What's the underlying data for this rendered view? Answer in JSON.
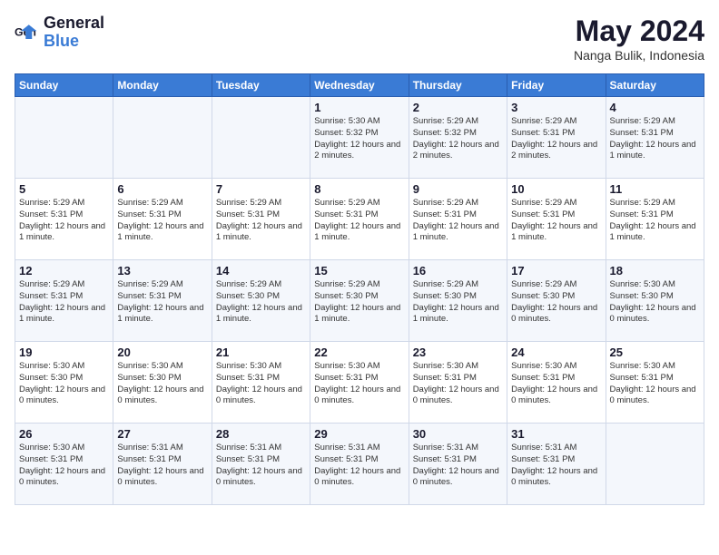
{
  "logo": {
    "text_general": "General",
    "text_blue": "Blue"
  },
  "header": {
    "month": "May 2024",
    "location": "Nanga Bulik, Indonesia"
  },
  "weekdays": [
    "Sunday",
    "Monday",
    "Tuesday",
    "Wednesday",
    "Thursday",
    "Friday",
    "Saturday"
  ],
  "weeks": [
    [
      {
        "day": "",
        "sunrise": "",
        "sunset": "",
        "daylight": ""
      },
      {
        "day": "",
        "sunrise": "",
        "sunset": "",
        "daylight": ""
      },
      {
        "day": "",
        "sunrise": "",
        "sunset": "",
        "daylight": ""
      },
      {
        "day": "1",
        "sunrise": "Sunrise: 5:30 AM",
        "sunset": "Sunset: 5:32 PM",
        "daylight": "Daylight: 12 hours and 2 minutes."
      },
      {
        "day": "2",
        "sunrise": "Sunrise: 5:29 AM",
        "sunset": "Sunset: 5:32 PM",
        "daylight": "Daylight: 12 hours and 2 minutes."
      },
      {
        "day": "3",
        "sunrise": "Sunrise: 5:29 AM",
        "sunset": "Sunset: 5:31 PM",
        "daylight": "Daylight: 12 hours and 2 minutes."
      },
      {
        "day": "4",
        "sunrise": "Sunrise: 5:29 AM",
        "sunset": "Sunset: 5:31 PM",
        "daylight": "Daylight: 12 hours and 1 minute."
      }
    ],
    [
      {
        "day": "5",
        "sunrise": "Sunrise: 5:29 AM",
        "sunset": "Sunset: 5:31 PM",
        "daylight": "Daylight: 12 hours and 1 minute."
      },
      {
        "day": "6",
        "sunrise": "Sunrise: 5:29 AM",
        "sunset": "Sunset: 5:31 PM",
        "daylight": "Daylight: 12 hours and 1 minute."
      },
      {
        "day": "7",
        "sunrise": "Sunrise: 5:29 AM",
        "sunset": "Sunset: 5:31 PM",
        "daylight": "Daylight: 12 hours and 1 minute."
      },
      {
        "day": "8",
        "sunrise": "Sunrise: 5:29 AM",
        "sunset": "Sunset: 5:31 PM",
        "daylight": "Daylight: 12 hours and 1 minute."
      },
      {
        "day": "9",
        "sunrise": "Sunrise: 5:29 AM",
        "sunset": "Sunset: 5:31 PM",
        "daylight": "Daylight: 12 hours and 1 minute."
      },
      {
        "day": "10",
        "sunrise": "Sunrise: 5:29 AM",
        "sunset": "Sunset: 5:31 PM",
        "daylight": "Daylight: 12 hours and 1 minute."
      },
      {
        "day": "11",
        "sunrise": "Sunrise: 5:29 AM",
        "sunset": "Sunset: 5:31 PM",
        "daylight": "Daylight: 12 hours and 1 minute."
      }
    ],
    [
      {
        "day": "12",
        "sunrise": "Sunrise: 5:29 AM",
        "sunset": "Sunset: 5:31 PM",
        "daylight": "Daylight: 12 hours and 1 minute."
      },
      {
        "day": "13",
        "sunrise": "Sunrise: 5:29 AM",
        "sunset": "Sunset: 5:31 PM",
        "daylight": "Daylight: 12 hours and 1 minute."
      },
      {
        "day": "14",
        "sunrise": "Sunrise: 5:29 AM",
        "sunset": "Sunset: 5:30 PM",
        "daylight": "Daylight: 12 hours and 1 minute."
      },
      {
        "day": "15",
        "sunrise": "Sunrise: 5:29 AM",
        "sunset": "Sunset: 5:30 PM",
        "daylight": "Daylight: 12 hours and 1 minute."
      },
      {
        "day": "16",
        "sunrise": "Sunrise: 5:29 AM",
        "sunset": "Sunset: 5:30 PM",
        "daylight": "Daylight: 12 hours and 1 minute."
      },
      {
        "day": "17",
        "sunrise": "Sunrise: 5:29 AM",
        "sunset": "Sunset: 5:30 PM",
        "daylight": "Daylight: 12 hours and 0 minutes."
      },
      {
        "day": "18",
        "sunrise": "Sunrise: 5:30 AM",
        "sunset": "Sunset: 5:30 PM",
        "daylight": "Daylight: 12 hours and 0 minutes."
      }
    ],
    [
      {
        "day": "19",
        "sunrise": "Sunrise: 5:30 AM",
        "sunset": "Sunset: 5:30 PM",
        "daylight": "Daylight: 12 hours and 0 minutes."
      },
      {
        "day": "20",
        "sunrise": "Sunrise: 5:30 AM",
        "sunset": "Sunset: 5:30 PM",
        "daylight": "Daylight: 12 hours and 0 minutes."
      },
      {
        "day": "21",
        "sunrise": "Sunrise: 5:30 AM",
        "sunset": "Sunset: 5:31 PM",
        "daylight": "Daylight: 12 hours and 0 minutes."
      },
      {
        "day": "22",
        "sunrise": "Sunrise: 5:30 AM",
        "sunset": "Sunset: 5:31 PM",
        "daylight": "Daylight: 12 hours and 0 minutes."
      },
      {
        "day": "23",
        "sunrise": "Sunrise: 5:30 AM",
        "sunset": "Sunset: 5:31 PM",
        "daylight": "Daylight: 12 hours and 0 minutes."
      },
      {
        "day": "24",
        "sunrise": "Sunrise: 5:30 AM",
        "sunset": "Sunset: 5:31 PM",
        "daylight": "Daylight: 12 hours and 0 minutes."
      },
      {
        "day": "25",
        "sunrise": "Sunrise: 5:30 AM",
        "sunset": "Sunset: 5:31 PM",
        "daylight": "Daylight: 12 hours and 0 minutes."
      }
    ],
    [
      {
        "day": "26",
        "sunrise": "Sunrise: 5:30 AM",
        "sunset": "Sunset: 5:31 PM",
        "daylight": "Daylight: 12 hours and 0 minutes."
      },
      {
        "day": "27",
        "sunrise": "Sunrise: 5:31 AM",
        "sunset": "Sunset: 5:31 PM",
        "daylight": "Daylight: 12 hours and 0 minutes."
      },
      {
        "day": "28",
        "sunrise": "Sunrise: 5:31 AM",
        "sunset": "Sunset: 5:31 PM",
        "daylight": "Daylight: 12 hours and 0 minutes."
      },
      {
        "day": "29",
        "sunrise": "Sunrise: 5:31 AM",
        "sunset": "Sunset: 5:31 PM",
        "daylight": "Daylight: 12 hours and 0 minutes."
      },
      {
        "day": "30",
        "sunrise": "Sunrise: 5:31 AM",
        "sunset": "Sunset: 5:31 PM",
        "daylight": "Daylight: 12 hours and 0 minutes."
      },
      {
        "day": "31",
        "sunrise": "Sunrise: 5:31 AM",
        "sunset": "Sunset: 5:31 PM",
        "daylight": "Daylight: 12 hours and 0 minutes."
      },
      {
        "day": "",
        "sunrise": "",
        "sunset": "",
        "daylight": ""
      }
    ]
  ]
}
